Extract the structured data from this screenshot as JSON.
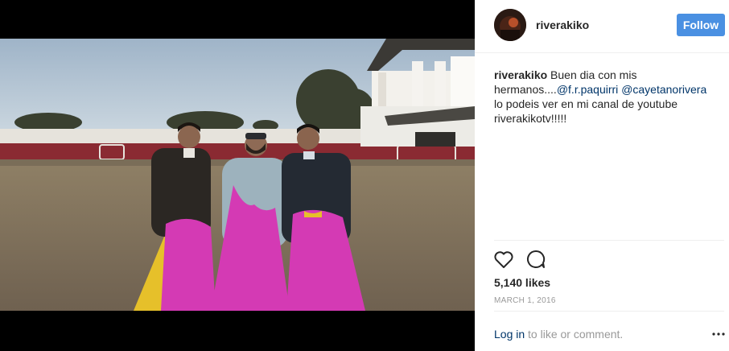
{
  "post": {
    "username": "riverakiko",
    "follow_label": "Follow",
    "caption": {
      "username": "riverakiko",
      "text_1": " Buen dia con mis hermanos....",
      "mention_1": "@f.r.paquirri",
      "text_2": " ",
      "mention_2": "@cayetanorivera",
      "text_3": " lo podeis ver en mi canal de youtube riverakikotv!!!!!"
    },
    "likes": "5,140 likes",
    "date": "MARCH 1, 2016",
    "footer": {
      "login_link": "Log in",
      "login_rest": " to like or comment."
    }
  },
  "icons": {
    "like": "heart-icon",
    "comment": "comment-icon",
    "more": "more-options-icon"
  },
  "colors": {
    "follow_button": "#4a90e2",
    "mention_link": "#003569",
    "muted_text": "#999999",
    "cape_magenta": "#d43ab4",
    "cape_yellow": "#e6c02a"
  }
}
